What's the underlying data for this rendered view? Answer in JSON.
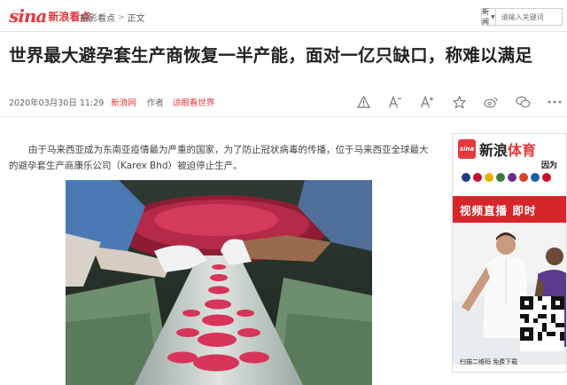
{
  "header": {
    "logo_brand": "sina",
    "logo_text": "新浪看点",
    "breadcrumb": [
      "摄影看点",
      "正文"
    ],
    "breadcrumb_sep": ">",
    "search": {
      "category": "新闻",
      "placeholder": "请输入关键词"
    }
  },
  "article": {
    "title": "世界最大避孕套生产商恢复一半产能，面对一亿只缺口，称难以满足",
    "meta": {
      "datetime": "2020年03月30日 11:29",
      "source": "新浪网",
      "author_label": "作者",
      "author": "谅眼看世界"
    },
    "toolbar_icons": [
      "report-icon",
      "font-decrease-icon",
      "font-increase-icon",
      "favorite-star-icon",
      "weibo-share-icon",
      "wechat-share-icon",
      "more-icon"
    ],
    "body": "由于马来西亚成为东南亚疫情最为严重的国家，为了防止冠状病毒的传播，位于马来西亚全球最大的避孕套生产商康乐公司（Karex Bhd）被迫停止生产。"
  },
  "ad": {
    "logo_mark": "sina",
    "brand_a": "新浪",
    "brand_b": "体育",
    "subtitle": "因为",
    "banner": "视频直播  即时",
    "qr_label": "扫描二维码  免费下载"
  },
  "colors": {
    "brand_red": "#e4393c",
    "banner_red": "#d7262b"
  }
}
